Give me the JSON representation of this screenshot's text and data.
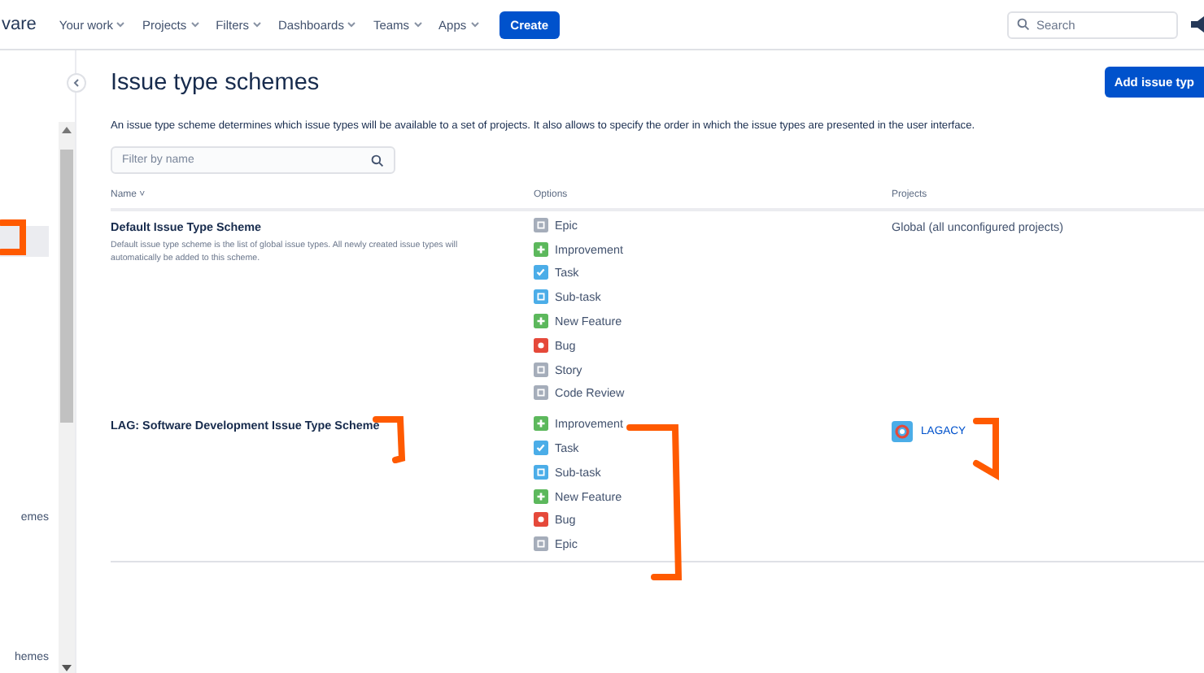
{
  "nav": {
    "logo": "vare",
    "items": [
      "Your work",
      "Projects",
      "Filters",
      "Dashboards",
      "Teams",
      "Apps"
    ],
    "create": "Create",
    "search": {
      "placeholder": "Search"
    }
  },
  "sidebar": {
    "items": [
      {
        "selected": true
      },
      {
        "label": "emes",
        "selected": false
      },
      {
        "label": "hemes",
        "selected": false
      }
    ]
  },
  "page": {
    "title": "Issue type schemes",
    "add_button": "Add issue typ",
    "description": "An issue type scheme determines which issue types will be available to a set of projects. It also allows to specify the order in which the issue types are presented in the user interface.",
    "filter": {
      "placeholder": "Filter by name"
    }
  },
  "table": {
    "columns": [
      "Name",
      "Options",
      "Projects"
    ],
    "sort_indicator": "˅",
    "rows": [
      {
        "name": "Default Issue Type Scheme",
        "description": "Default issue type scheme is the list of global issue types. All newly created issue types will automatically be added to this scheme.",
        "options": [
          {
            "kind": "epic",
            "label": "Epic"
          },
          {
            "kind": "improvement",
            "label": "Improvement"
          },
          {
            "kind": "task",
            "label": "Task"
          },
          {
            "kind": "subtask",
            "label": "Sub-task"
          },
          {
            "kind": "feature",
            "label": "New Feature"
          },
          {
            "kind": "bug",
            "label": "Bug"
          },
          {
            "kind": "story",
            "label": "Story"
          },
          {
            "kind": "story",
            "label": "Code Review"
          }
        ],
        "projects": [
          {
            "kind": "text",
            "label": "Global (all unconfigured projects)"
          }
        ]
      },
      {
        "name": "LAG: Software Development Issue Type Scheme",
        "options": [
          {
            "kind": "improvement",
            "label": "Improvement"
          },
          {
            "kind": "task",
            "label": "Task"
          },
          {
            "kind": "subtask",
            "label": "Sub-task"
          },
          {
            "kind": "feature",
            "label": "New Feature"
          },
          {
            "kind": "bug",
            "label": "Bug"
          },
          {
            "kind": "epic",
            "label": "Epic"
          }
        ],
        "projects": [
          {
            "kind": "link",
            "label": "LAGACY"
          }
        ]
      }
    ]
  }
}
